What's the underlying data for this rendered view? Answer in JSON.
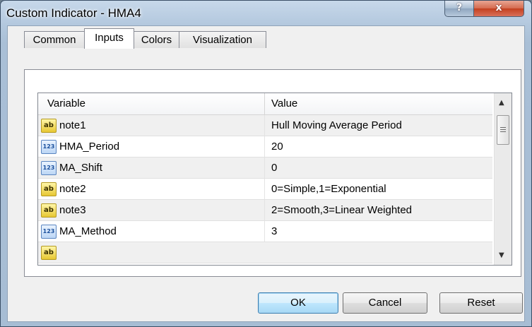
{
  "window": {
    "title": "Custom Indicator - HMA4",
    "help_label": "?",
    "close_label": "x"
  },
  "tabs": [
    {
      "label": "Common",
      "active": false
    },
    {
      "label": "Inputs",
      "active": true
    },
    {
      "label": "Colors",
      "active": false
    },
    {
      "label": "Visualization",
      "active": false
    }
  ],
  "table": {
    "columns": {
      "variable": "Variable",
      "value": "Value"
    },
    "rows": [
      {
        "icon": "ab",
        "name": "note1",
        "value": "Hull Moving Average Period"
      },
      {
        "icon": "123",
        "name": "HMA_Period",
        "value": "20"
      },
      {
        "icon": "123",
        "name": "MA_Shift",
        "value": "0"
      },
      {
        "icon": "ab",
        "name": "note2",
        "value": "0=Simple,1=Exponential"
      },
      {
        "icon": "ab",
        "name": "note3",
        "value": "2=Smooth,3=Linear Weighted"
      },
      {
        "icon": "123",
        "name": "MA_Method",
        "value": "3"
      }
    ]
  },
  "buttons": {
    "ok": "OK",
    "cancel": "Cancel",
    "reset": "Reset"
  }
}
